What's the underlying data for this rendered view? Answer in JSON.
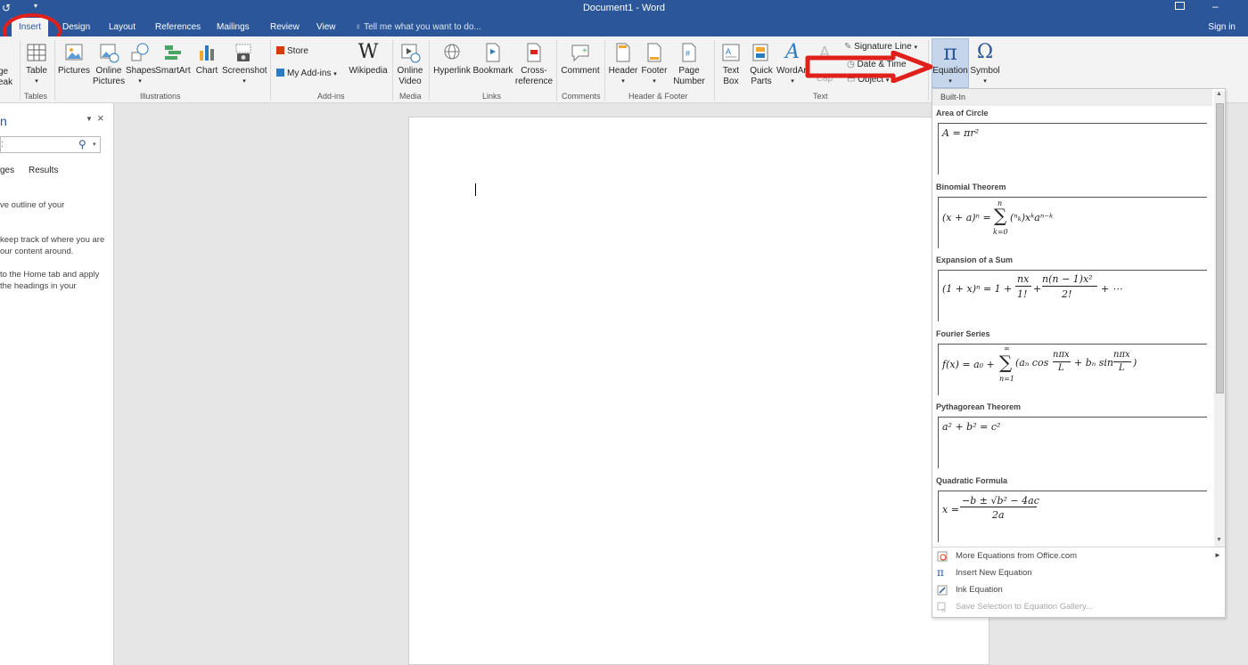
{
  "window": {
    "title": "Document1 - Word",
    "sign_in": "Sign in",
    "tell_me": "Tell me what you want to do..."
  },
  "tabs": [
    "Insert",
    "Design",
    "Layout",
    "References",
    "Mailings",
    "Review",
    "View"
  ],
  "ribbon": {
    "page_break_partial": [
      "ge",
      "eak"
    ],
    "table": "Table",
    "pictures": "Pictures",
    "online_pictures": [
      "Online",
      "Pictures"
    ],
    "shapes": "Shapes",
    "smartart": "SmartArt",
    "chart": "Chart",
    "screenshot": "Screenshot",
    "store": "Store",
    "my_addins": "My Add-ins",
    "wikipedia": "Wikipedia",
    "online_video": [
      "Online",
      "Video"
    ],
    "hyperlink": "Hyperlink",
    "bookmark": "Bookmark",
    "cross_reference": [
      "Cross-",
      "reference"
    ],
    "comment": "Comment",
    "header": "Header",
    "footer": "Footer",
    "page_number": [
      "Page",
      "Number"
    ],
    "text_box": [
      "Text",
      "Box"
    ],
    "quick_parts": [
      "Quick",
      "Parts"
    ],
    "wordart": "WordArt",
    "drop_cap": "Cap",
    "signature_line": "Signature Line",
    "date_time": "Date & Time",
    "object": "Object",
    "equation": "Equation",
    "symbol": "Symbol",
    "groups": {
      "tables": "Tables",
      "illustrations": "Illustrations",
      "addins": "Add-ins",
      "media": "Media",
      "links": "Links",
      "comments": "Comments",
      "header_footer": "Header & Footer",
      "text": "Text"
    }
  },
  "nav_pane": {
    "title_partial": "n",
    "tab_partial": "ges",
    "tab_results": "Results",
    "lines": [
      "ve outline of your",
      "keep track of where you are",
      "our content around.",
      "to the Home tab and apply",
      "the headings in your"
    ]
  },
  "gallery": {
    "header": "Built-In",
    "equations": [
      {
        "title": "Area of Circle"
      },
      {
        "title": "Binomial Theorem"
      },
      {
        "title": "Expansion of a Sum"
      },
      {
        "title": "Fourier Series"
      },
      {
        "title": "Pythagorean Theorem"
      },
      {
        "title": "Quadratic Formula"
      }
    ],
    "menu": [
      {
        "label": "More Equations from Office.com",
        "icon": "office-globe-icon",
        "enabled": true
      },
      {
        "label": "Insert New Equation",
        "icon": "pi-icon",
        "enabled": true
      },
      {
        "label": "Ink Equation",
        "icon": "ink-pen-icon",
        "enabled": true
      },
      {
        "label": "Save Selection to Equation Gallery...",
        "icon": "save-equation-icon",
        "enabled": false
      }
    ]
  },
  "annotation": {
    "circle_color": "#e0201b",
    "arrow_color": "#e0201b"
  },
  "colors": {
    "title_bar": "#2b579a",
    "ribbon": "#f3f3f3",
    "accent": "#2b579a"
  }
}
